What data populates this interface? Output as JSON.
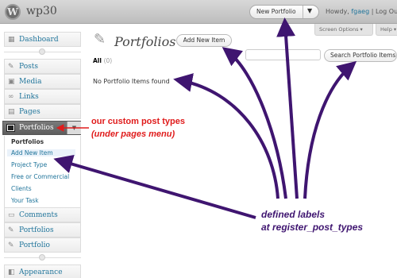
{
  "header": {
    "site_title": "wp30",
    "favorite_action": "New Portfolio",
    "howdy_prefix": "Howdy, ",
    "username": "fgaeg",
    "separator": " | ",
    "logout": "Log Out",
    "dropdown_glyph": "▼"
  },
  "screen_meta": {
    "screen_options": "Screen Options ▾",
    "help": "Help ▾"
  },
  "sidebar": {
    "dashboard": "Dashboard",
    "posts": "Posts",
    "media": "Media",
    "links": "Links",
    "pages": "Pages",
    "portfolios_current": "Portfolios",
    "toggle_glyph": "▼",
    "submenu": {
      "portfolios": "Portfolios",
      "add_new_item": "Add New Item",
      "project_type": "Project Type",
      "free_or_commercial": "Free or Commercial",
      "clients": "Clients",
      "your_task": "Your Task"
    },
    "comments": "Comments",
    "portfolios_2": "Portfolios",
    "portfolio": "Portfolio",
    "appearance": "Appearance"
  },
  "main": {
    "page_title": "Portfolios",
    "add_new_button": "Add New Item",
    "filter_all": "All",
    "filter_count": "(0)",
    "search_placeholder": "",
    "search_button": "Search Portfolio Items",
    "empty_message": "No Portfolio Items found"
  },
  "annotations": {
    "custom_post_types": "our custom post types",
    "under_pages_menu": "(under pages menu)",
    "defined_labels": "defined labels",
    "register_post_types": "at register_post_types",
    "red_color": "#e01b1b",
    "purple_color": "#3f1570"
  },
  "icons": {
    "logo": "wordpress-logo-icon",
    "page": "pushpin-icon"
  }
}
